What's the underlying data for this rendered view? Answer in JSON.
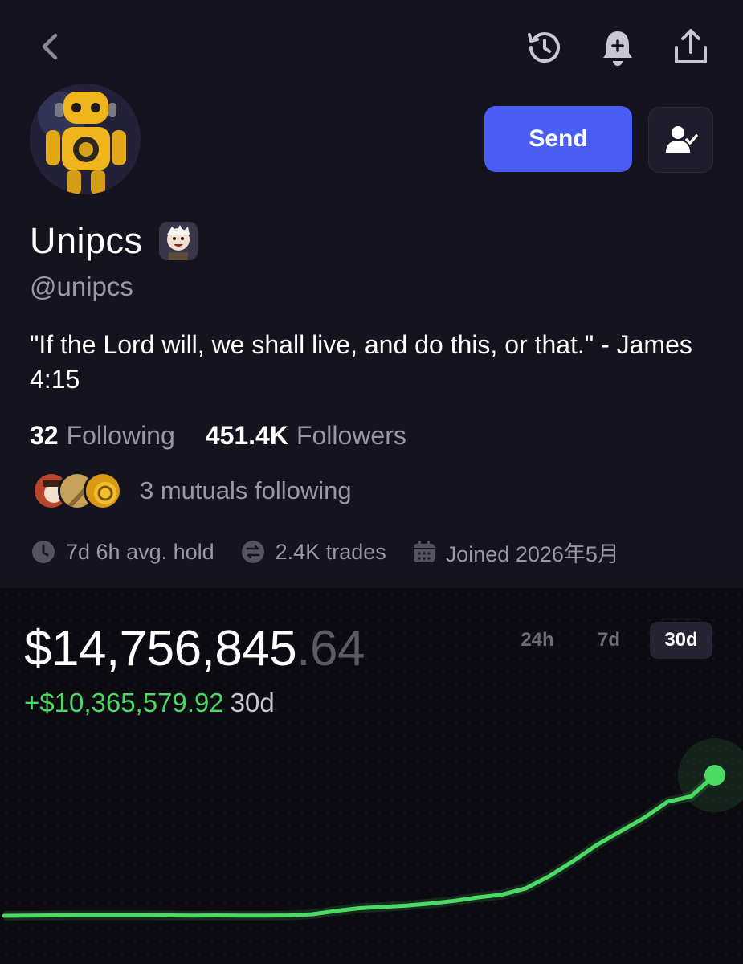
{
  "header": {
    "back_icon": "chevron-left-icon",
    "history_icon": "history-icon",
    "bell_icon": "bell-plus-icon",
    "share_icon": "share-icon"
  },
  "profile": {
    "display_name": "Unipcs",
    "handle": "@unipcs",
    "bio": "\"If the Lord will, we shall live, and do this, or that.\" - James 4:15",
    "send_label": "Send",
    "following_count": "32",
    "following_label": "Following",
    "followers_count": "451.4K",
    "followers_label": "Followers",
    "mutuals_text": "3 mutuals following",
    "avg_hold": "7d 6h avg. hold",
    "trades": "2.4K trades",
    "joined": "Joined 2026年5月"
  },
  "portfolio": {
    "balance_main": "$14,756,845",
    "balance_cents": ".64",
    "change_amount": "+$10,365,579.92",
    "change_period": "30d",
    "ranges": [
      "24h",
      "7d",
      "30d"
    ],
    "selected_range": "30d"
  },
  "colors": {
    "accent": "#4a5ef5",
    "positive": "#4cd964",
    "background": "#15131e",
    "chart_background": "#0c0b12"
  },
  "chart_data": {
    "type": "line",
    "title": "",
    "xlabel": "",
    "ylabel": "",
    "x": [
      0,
      1,
      2,
      3,
      4,
      5,
      6,
      7,
      8,
      9,
      10,
      11,
      12,
      13,
      14,
      15,
      16,
      17,
      18,
      19,
      20,
      21,
      22,
      23,
      24,
      25,
      26,
      27,
      28,
      29,
      30
    ],
    "series": [
      {
        "values": [
          4.39,
          4.4,
          4.42,
          4.43,
          4.44,
          4.44,
          4.43,
          4.42,
          4.41,
          4.42,
          4.4,
          4.41,
          4.42,
          4.5,
          4.75,
          4.95,
          5.05,
          5.15,
          5.3,
          5.5,
          5.75,
          5.95,
          6.4,
          7.3,
          8.4,
          9.6,
          10.6,
          11.6,
          12.8,
          13.2,
          14.76
        ]
      }
    ],
    "grid": false,
    "legend": "none"
  }
}
